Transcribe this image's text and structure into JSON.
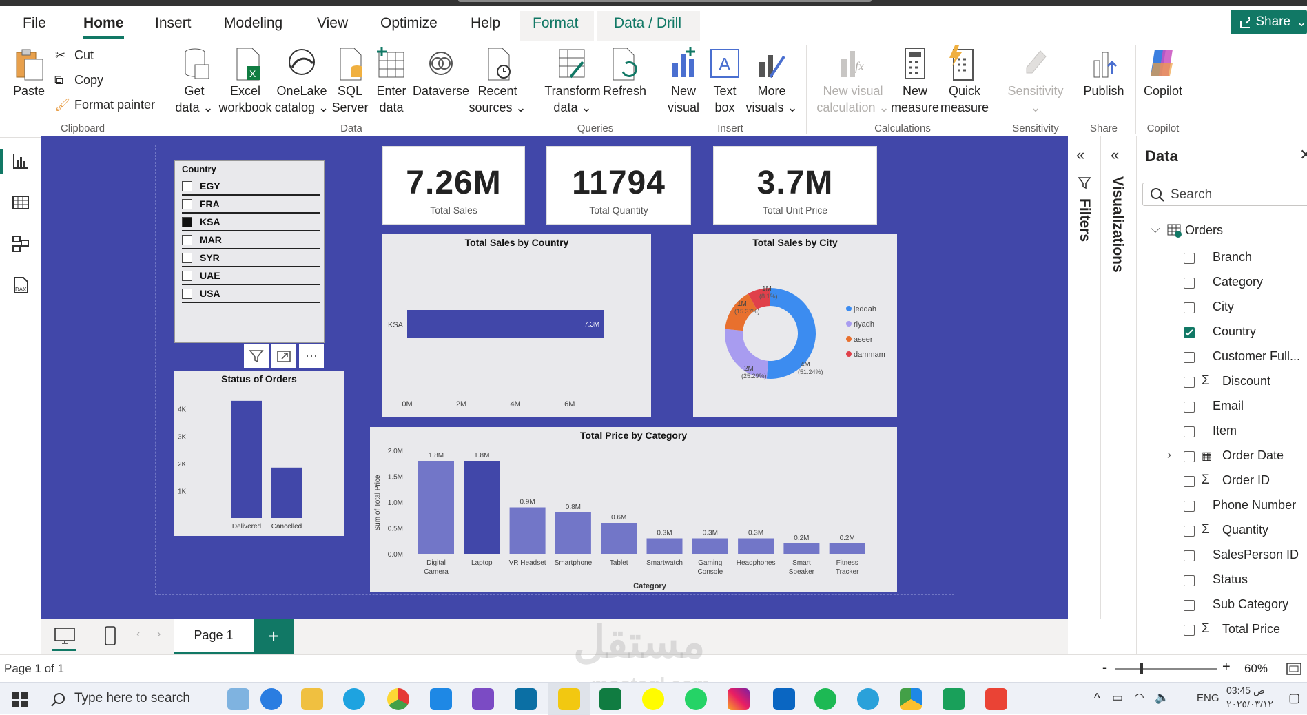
{
  "menu": {
    "tabs": [
      "File",
      "Home",
      "Insert",
      "Modeling",
      "View",
      "Optimize",
      "Help",
      "Format",
      "Data / Drill"
    ],
    "share": "Share"
  },
  "ribbon": {
    "clipboard": {
      "paste": "Paste",
      "cut": "Cut",
      "copy": "Copy",
      "format_painter": "Format painter",
      "group": "Clipboard"
    },
    "data": {
      "get_data": [
        "Get",
        "data"
      ],
      "excel": [
        "Excel",
        "workbook"
      ],
      "onelake": [
        "OneLake",
        "catalog"
      ],
      "sql": [
        "SQL",
        "Server"
      ],
      "enter": [
        "Enter",
        "data"
      ],
      "dataverse": "Dataverse",
      "recent": [
        "Recent",
        "sources"
      ],
      "group": "Data"
    },
    "queries": {
      "transform": [
        "Transform",
        "data"
      ],
      "refresh": "Refresh",
      "group": "Queries"
    },
    "insert": {
      "new_visual": [
        "New",
        "visual"
      ],
      "text_box": [
        "Text",
        "box"
      ],
      "more_visuals": [
        "More",
        "visuals"
      ],
      "group": "Insert"
    },
    "calculations": {
      "new_visual_calc": [
        "New visual",
        "calculation"
      ],
      "new_measure": [
        "New",
        "measure"
      ],
      "quick_measure": [
        "Quick",
        "measure"
      ],
      "group": "Calculations"
    },
    "sensitivity": {
      "label": "Sensitivity",
      "group": "Sensitivity"
    },
    "share": {
      "publish": "Publish",
      "group": "Share"
    },
    "copilot": {
      "label": "Copilot",
      "group": "Copilot"
    }
  },
  "slicer": {
    "title": "Country",
    "items": [
      {
        "label": "EGY",
        "checked": false
      },
      {
        "label": "FRA",
        "checked": false
      },
      {
        "label": "KSA",
        "checked": true
      },
      {
        "label": "MAR",
        "checked": false
      },
      {
        "label": "SYR",
        "checked": false
      },
      {
        "label": "UAE",
        "checked": false
      },
      {
        "label": "USA",
        "checked": false
      }
    ]
  },
  "kpis": [
    {
      "value": "7.26M",
      "label": "Total Sales"
    },
    {
      "value": "11794",
      "label": "Total Quantity"
    },
    {
      "value": "3.7M",
      "label": "Total Unit Price"
    }
  ],
  "chart_data": [
    {
      "type": "bar",
      "title": "Total Sales by Country",
      "orientation": "horizontal",
      "categories": [
        "KSA"
      ],
      "values": [
        7.26
      ],
      "data_labels": [
        "7.3M"
      ],
      "x_ticks": [
        "0M",
        "2M",
        "4M",
        "6M"
      ],
      "xlim": [
        0,
        8.5
      ]
    },
    {
      "type": "pie",
      "variant": "donut",
      "title": "Total Sales by City",
      "labels": [
        "jeddah",
        "riyadh",
        "aseer",
        "dammam"
      ],
      "values": [
        4,
        2,
        1,
        1
      ],
      "percents": [
        51.24,
        25.29,
        15.37,
        8.1
      ],
      "data_labels": [
        {
          "v": "4M",
          "p": "(51.24%)"
        },
        {
          "v": "2M",
          "p": "(25.29%)"
        },
        {
          "v": "1M",
          "p": "(15.37%)"
        },
        {
          "v": "1M",
          "p": "(8.1%)"
        }
      ],
      "colors": [
        "#3c8cf0",
        "#a89cf0",
        "#e8702e",
        "#e0404a"
      ],
      "legend": "right"
    },
    {
      "type": "bar",
      "title": "Status of Orders",
      "categories": [
        "Delivered",
        "Cancelled"
      ],
      "values": [
        4300,
        1850
      ],
      "y_ticks": [
        "1K",
        "2K",
        "3K",
        "4K"
      ],
      "ylim": [
        0,
        4600
      ]
    },
    {
      "type": "bar",
      "title": "Total Price by Category",
      "xlabel": "Category",
      "ylabel": "Sum of Total Price",
      "categories": [
        [
          "Digital",
          "Camera"
        ],
        [
          "Laptop"
        ],
        [
          "VR Headset"
        ],
        [
          "Smartphone"
        ],
        [
          "Tablet"
        ],
        [
          "Smartwatch"
        ],
        [
          "Gaming",
          "Console"
        ],
        [
          "Headphones"
        ],
        [
          "Smart",
          "Speaker"
        ],
        [
          "Fitness",
          "Tracker"
        ]
      ],
      "values": [
        1.8,
        1.8,
        0.9,
        0.8,
        0.6,
        0.3,
        0.3,
        0.3,
        0.2,
        0.2
      ],
      "data_labels": [
        "1.8M",
        "1.8M",
        "0.9M",
        "0.8M",
        "0.6M",
        "0.3M",
        "0.3M",
        "0.3M",
        "0.2M",
        "0.2M"
      ],
      "y_ticks": [
        "0.0M",
        "0.5M",
        "1.0M",
        "1.5M",
        "2.0M"
      ],
      "ylim": [
        0,
        2.0
      ],
      "highlight": 1
    }
  ],
  "panels": {
    "filters": "Filters",
    "visualizations": "Visualizations",
    "data": "Data",
    "search_placeholder": "Search",
    "table": "Orders",
    "fields": [
      {
        "name": "Branch",
        "sigma": false,
        "checked": false
      },
      {
        "name": "Category",
        "sigma": false,
        "checked": false
      },
      {
        "name": "City",
        "sigma": false,
        "checked": false
      },
      {
        "name": "Country",
        "sigma": false,
        "checked": true
      },
      {
        "name": "Customer Full...",
        "sigma": false,
        "checked": false
      },
      {
        "name": "Discount",
        "sigma": true,
        "checked": false
      },
      {
        "name": "Email",
        "sigma": false,
        "checked": false
      },
      {
        "name": "Item",
        "sigma": false,
        "checked": false
      },
      {
        "name": "Order Date",
        "sigma": false,
        "checked": false,
        "date": true
      },
      {
        "name": "Order ID",
        "sigma": true,
        "checked": false
      },
      {
        "name": "Phone Number",
        "sigma": false,
        "checked": false
      },
      {
        "name": "Quantity",
        "sigma": true,
        "checked": false
      },
      {
        "name": "SalesPerson ID",
        "sigma": false,
        "checked": false
      },
      {
        "name": "Status",
        "sigma": false,
        "checked": false
      },
      {
        "name": "Sub Category",
        "sigma": false,
        "checked": false
      },
      {
        "name": "Total Price",
        "sigma": true,
        "checked": false
      }
    ]
  },
  "pages": {
    "tab": "Page 1",
    "add": "+",
    "status": "Page 1 of 1",
    "zoom": "60%"
  },
  "taskbar": {
    "search": "Type here to search",
    "lang": "ENG",
    "time": "03:45 ص",
    "date": "٢٠٢٥/٠٣/١٢"
  },
  "watermark": {
    "ar": "مستقل",
    "latin": "mostaql.com"
  }
}
